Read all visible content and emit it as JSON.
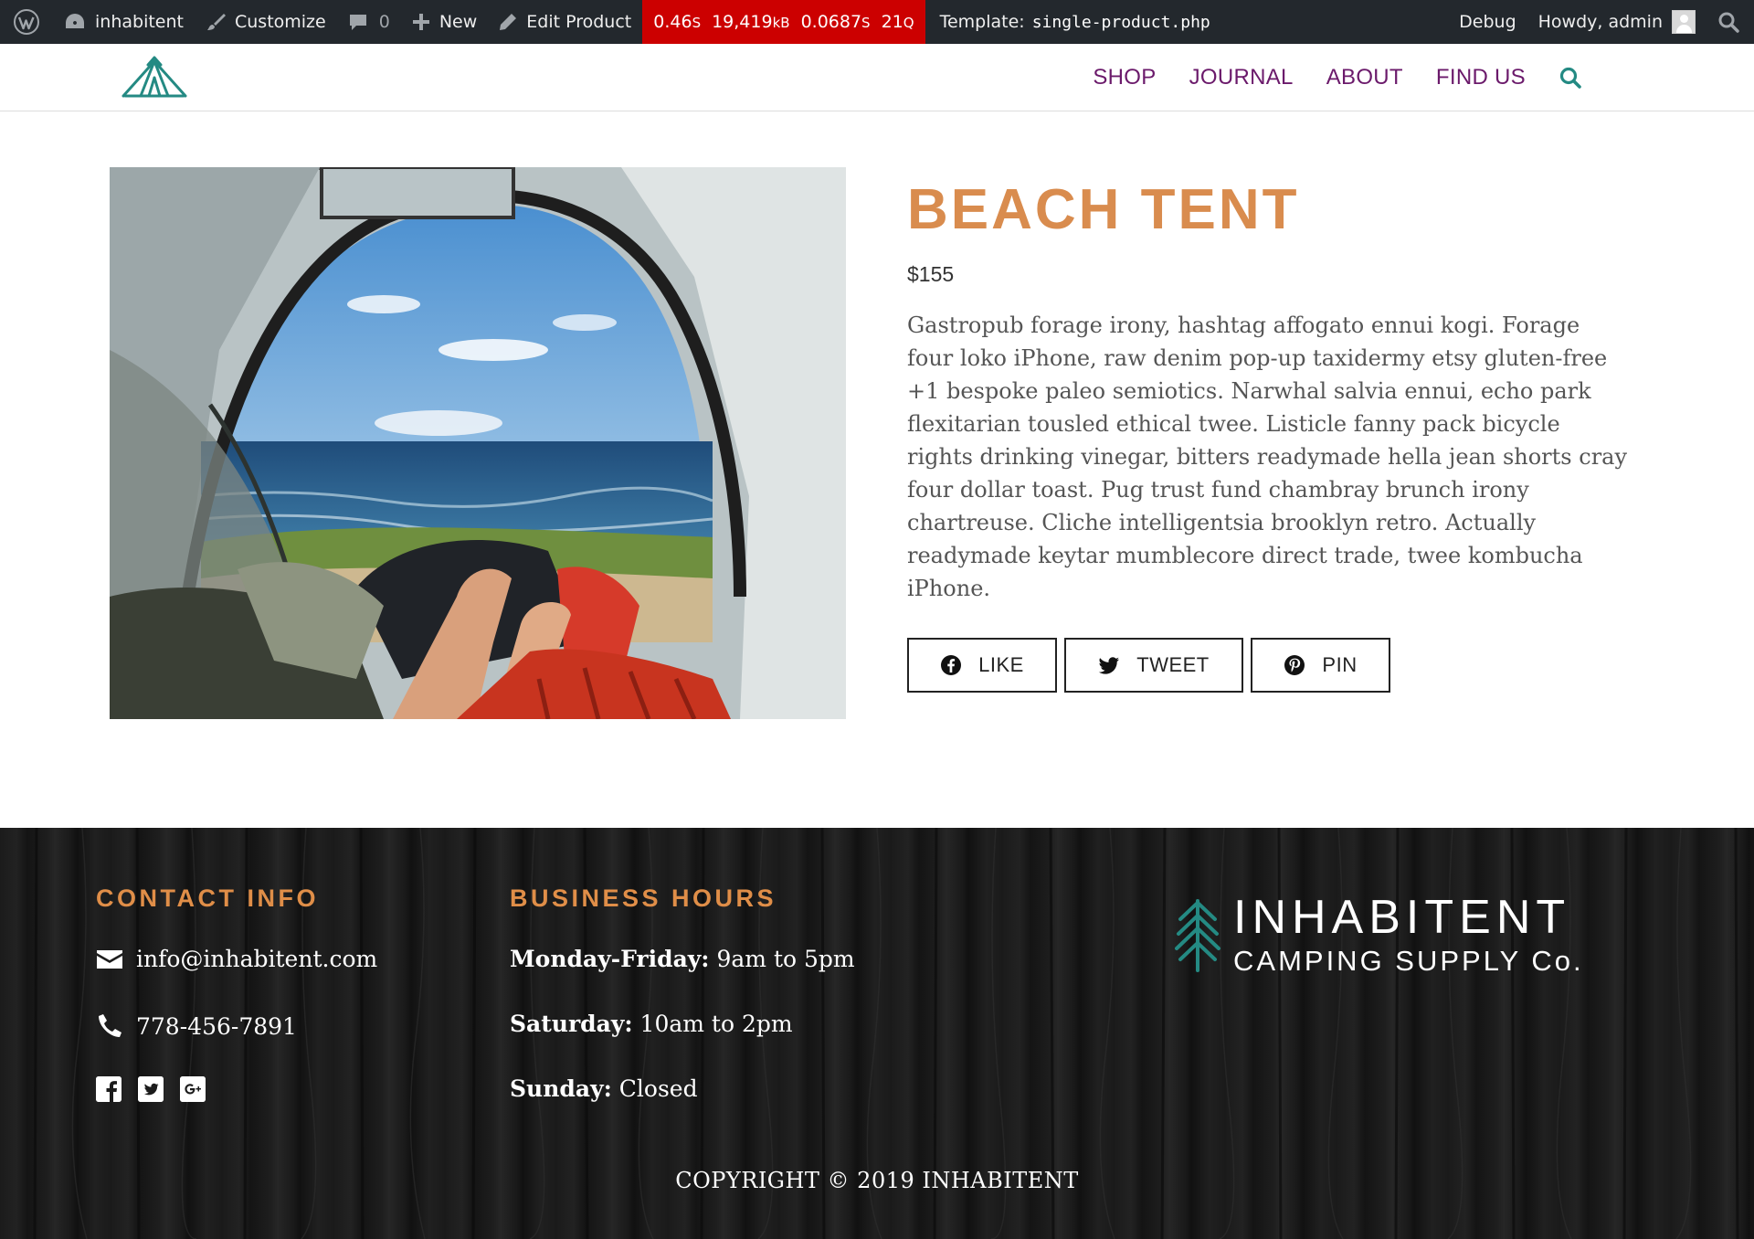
{
  "admin_bar": {
    "wp_logo_icon": "wordpress-icon",
    "site_name": "inhabitent",
    "customize": "Customize",
    "comments_count": "0",
    "new_label": "New",
    "edit_label": "Edit Product",
    "query_monitor": {
      "time": "0.46",
      "time_unit": "S",
      "memory": "19,419",
      "memory_unit": "kB",
      "db_time": "0.0687",
      "db_time_unit": "S",
      "queries": "21",
      "queries_unit": "Q",
      "background": "#cc0000"
    },
    "template_label": "Template:",
    "template_file": "single-product.php",
    "debug": "Debug",
    "howdy": "Howdy, admin"
  },
  "header": {
    "logo_icon": "tent-logo-icon",
    "nav": [
      {
        "label": "SHOP"
      },
      {
        "label": "JOURNAL"
      },
      {
        "label": "ABOUT"
      },
      {
        "label": "FIND US"
      }
    ],
    "nav_color": "#6b1a6b",
    "search_icon": "search-icon",
    "search_color": "#248a83"
  },
  "product": {
    "image_alt": "View from inside a tent looking out to the ocean",
    "title": "BEACH TENT",
    "title_color": "#d98c4e",
    "price": "$155",
    "description": "Gastropub forage irony, hashtag affogato ennui kogi. Forage four loko iPhone, raw denim pop-up taxidermy etsy gluten-free +1 bespoke paleo semiotics. Narwhal salvia ennui, echo park flexitarian tousled ethical twee. Listicle fanny pack bicycle rights drinking vinegar, bitters readymade hella jean shorts cray four dollar toast. Pug trust fund chambray brunch irony chartreuse. Cliche intelligentsia brooklyn retro. Actually readymade keytar mumblecore direct trade, twee kombucha iPhone.",
    "share": [
      {
        "label": "LIKE",
        "icon": "facebook-icon"
      },
      {
        "label": "TWEET",
        "icon": "twitter-icon"
      },
      {
        "label": "PIN",
        "icon": "pinterest-icon"
      }
    ]
  },
  "footer": {
    "contact": {
      "heading": "CONTACT INFO",
      "email": "info@inhabitent.com",
      "phone": "778-456-7891",
      "social": [
        "facebook-square-icon",
        "twitter-square-icon",
        "google-plus-square-icon"
      ]
    },
    "hours": {
      "heading": "BUSINESS HOURS",
      "lines": [
        {
          "day": "Monday-Friday:",
          "time": "9am to 5pm"
        },
        {
          "day": "Saturday:",
          "time": "10am to 2pm"
        },
        {
          "day": "Sunday:",
          "time": "Closed"
        }
      ]
    },
    "brand": {
      "name": "INHABITENT",
      "subtitle": "CAMPING SUPPLY Co.",
      "icon": "pine-tree-icon",
      "icon_color": "#248a83"
    },
    "heading_color": "#e08e48",
    "copyright": "COPYRIGHT © 2019 INHABITENT"
  }
}
